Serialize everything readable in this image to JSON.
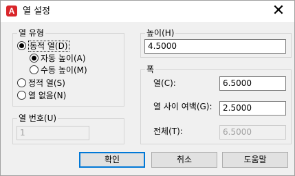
{
  "window": {
    "title": "열 설정",
    "app_icon_letter": "A",
    "close_glyph": "✕",
    "icon_color": "#d9262b"
  },
  "column_type": {
    "legend": "열 유형",
    "dynamic_label": "동적 열(D)",
    "auto_height_label": "자동 높이(A)",
    "manual_height_label": "수동 높이(M)",
    "static_label": "정적 열(S)",
    "none_label": "열 없음(N)",
    "selected": "dynamic",
    "selected_height": "auto"
  },
  "column_number": {
    "legend": "열 번호(U)",
    "value": "1"
  },
  "height": {
    "legend": "높이(H)",
    "value": "4.5000"
  },
  "width": {
    "legend": "폭",
    "column_label": "열(C):",
    "column_value": "6.5000",
    "gutter_label": "열 사이 여백(G):",
    "gutter_value": "2.5000",
    "total_label": "전체(T):",
    "total_value": "6.5000"
  },
  "buttons": {
    "ok": "확인",
    "cancel": "취소",
    "help": "도움말"
  }
}
